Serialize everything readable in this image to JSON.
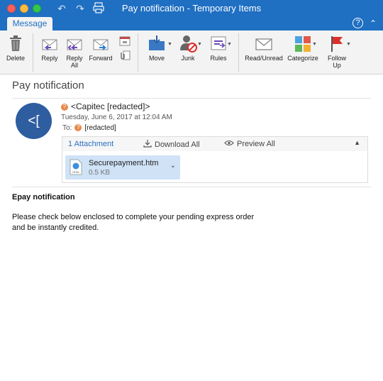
{
  "window": {
    "title": "Pay notification - Temporary Items"
  },
  "ribbon_tab": {
    "label": "Message"
  },
  "toolbar": {
    "delete": "Delete",
    "reply": "Reply",
    "reply_all": [
      "Reply",
      "All"
    ],
    "forward": "Forward",
    "move": "Move",
    "junk": "Junk",
    "rules": "Rules",
    "read_unread": "Read/Unread",
    "categorize": "Categorize",
    "follow_up": [
      "Follow",
      "Up"
    ]
  },
  "message": {
    "subject": "Pay notification",
    "avatar_initials": "<[",
    "sender": "<Capitec [redacted]>",
    "date": "Tuesday, June 6, 2017 at 12:04 AM",
    "to_label": "To:",
    "to_value": "[redacted]"
  },
  "attachments": {
    "count_label": "1 Attachment",
    "download_all": "Download All",
    "preview_all": "Preview All",
    "file": {
      "name": "Securepayment.htm",
      "size": "0.5 KB",
      "type_label": "HTML"
    }
  },
  "body": {
    "heading": "Epay notification",
    "paragraph": "Please check below enclosed to complete your pending express order and be instantly credited."
  },
  "colors": {
    "titlebar": "#1f6fc2",
    "avatar": "#2e5da0",
    "attachment_highlight": "#cfe2f6",
    "link": "#2a6fc4"
  }
}
